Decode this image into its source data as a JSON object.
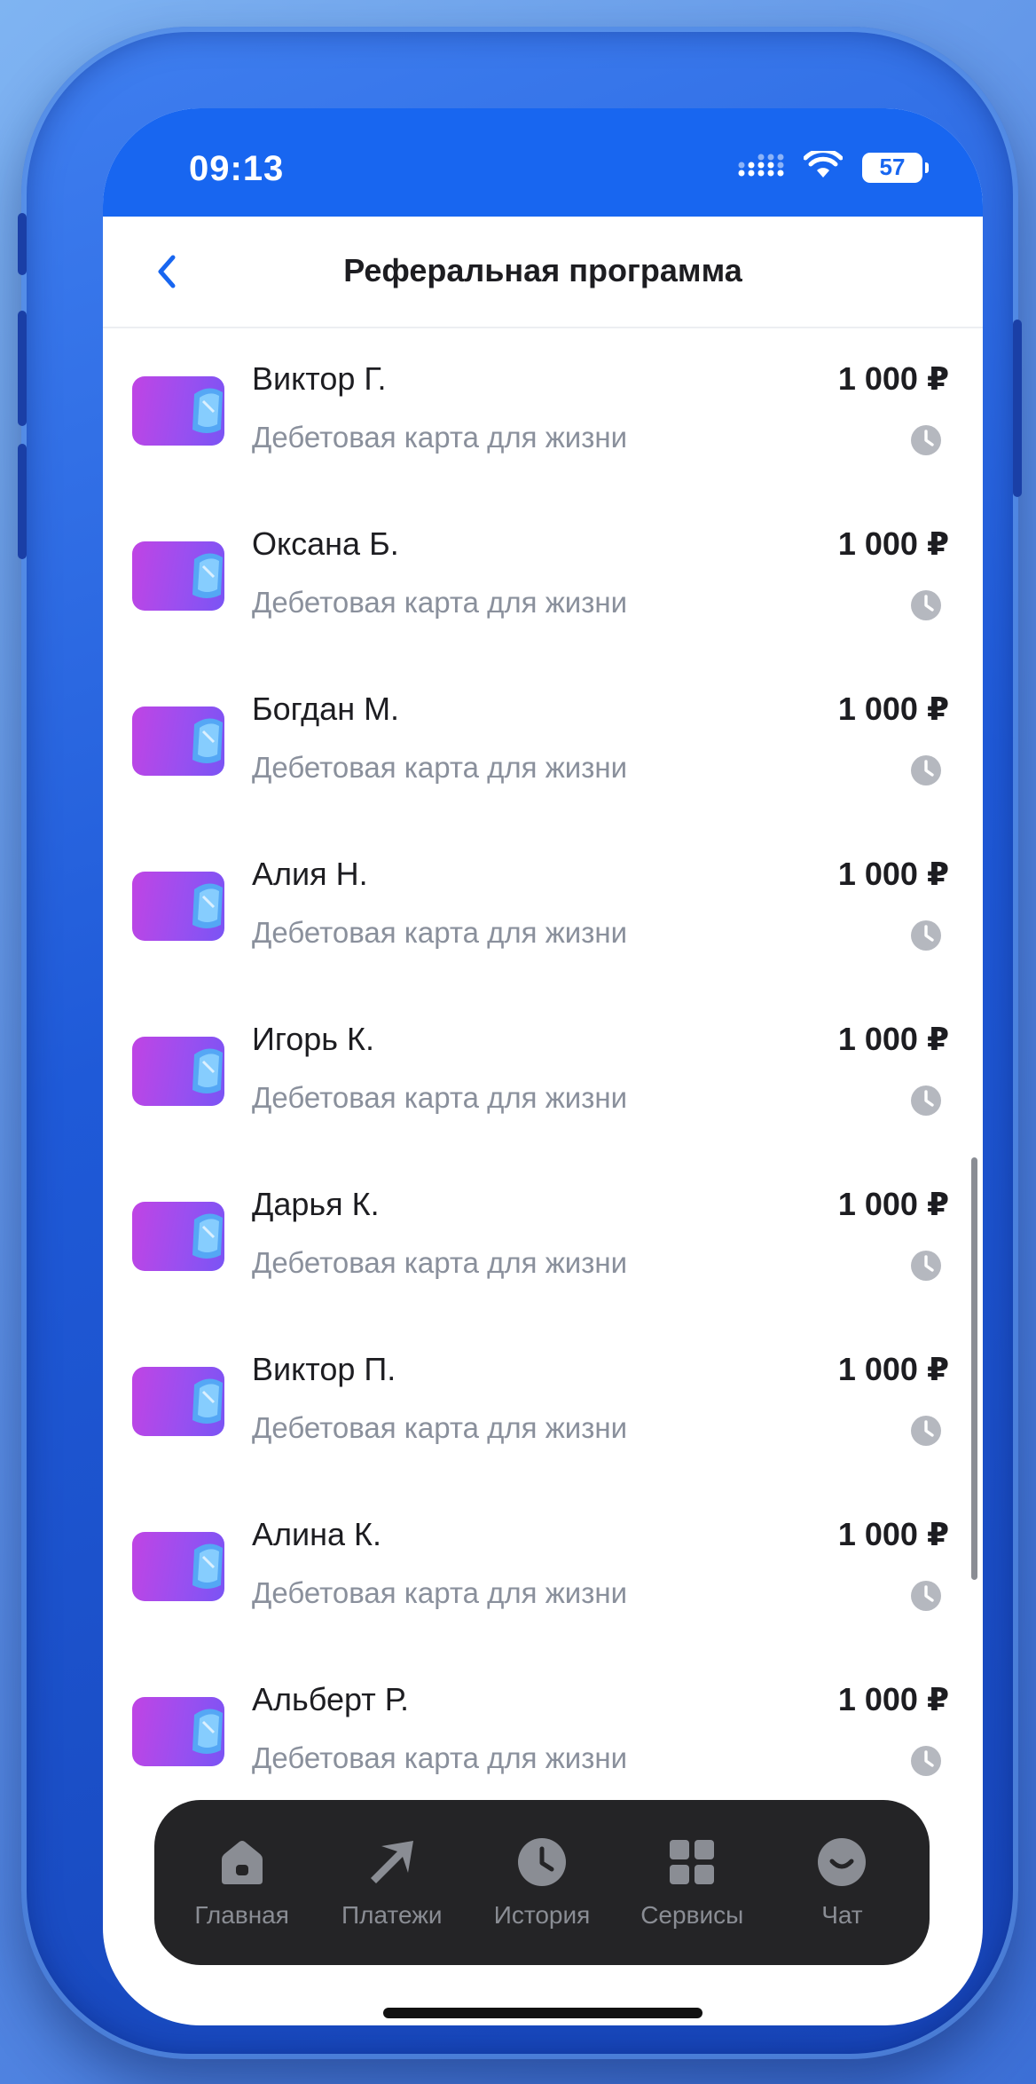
{
  "status_bar": {
    "time": "09:13",
    "battery": "57",
    "icons": [
      "signal-icon",
      "wifi-icon",
      "battery-icon"
    ]
  },
  "header": {
    "back_icon": "chevron-left-icon",
    "title": "Реферальная программа"
  },
  "referrals": [
    {
      "name": "Виктор Г.",
      "product": "Дебетовая карта для жизни",
      "amount": "1 000 ₽",
      "status_icon": "clock-icon"
    },
    {
      "name": "Оксана Б.",
      "product": "Дебетовая карта для жизни",
      "amount": "1 000 ₽",
      "status_icon": "clock-icon"
    },
    {
      "name": "Богдан М.",
      "product": "Дебетовая карта для жизни",
      "amount": "1 000 ₽",
      "status_icon": "clock-icon"
    },
    {
      "name": "Алия Н.",
      "product": "Дебетовая карта для жизни",
      "amount": "1 000 ₽",
      "status_icon": "clock-icon"
    },
    {
      "name": "Игорь К.",
      "product": "Дебетовая карта для жизни",
      "amount": "1 000 ₽",
      "status_icon": "clock-icon"
    },
    {
      "name": "Дарья К.",
      "product": "Дебетовая карта для жизни",
      "amount": "1 000 ₽",
      "status_icon": "clock-icon"
    },
    {
      "name": "Виктор П.",
      "product": "Дебетовая карта для жизни",
      "amount": "1 000 ₽",
      "status_icon": "clock-icon"
    },
    {
      "name": "Алина К.",
      "product": "Дебетовая карта для жизни",
      "amount": "1 000 ₽",
      "status_icon": "clock-icon"
    },
    {
      "name": "Альберт Р.",
      "product": "Дебетовая карта для жизни",
      "amount": "1 000 ₽",
      "status_icon": "clock-icon"
    }
  ],
  "tab_bar": {
    "tabs": [
      {
        "label": "Главная",
        "icon": "home-icon"
      },
      {
        "label": "Платежи",
        "icon": "arrow-icon"
      },
      {
        "label": "История",
        "icon": "clock-icon"
      },
      {
        "label": "Сервисы",
        "icon": "grid-icon"
      },
      {
        "label": "Чат",
        "icon": "chat-icon"
      }
    ]
  },
  "colors": {
    "brand_blue": "#1866f0",
    "tab_bar_bg": "#242426",
    "card_gradient_start": "#c044e4",
    "card_gradient_end": "#7a54f4",
    "muted_text": "#8a909c"
  }
}
